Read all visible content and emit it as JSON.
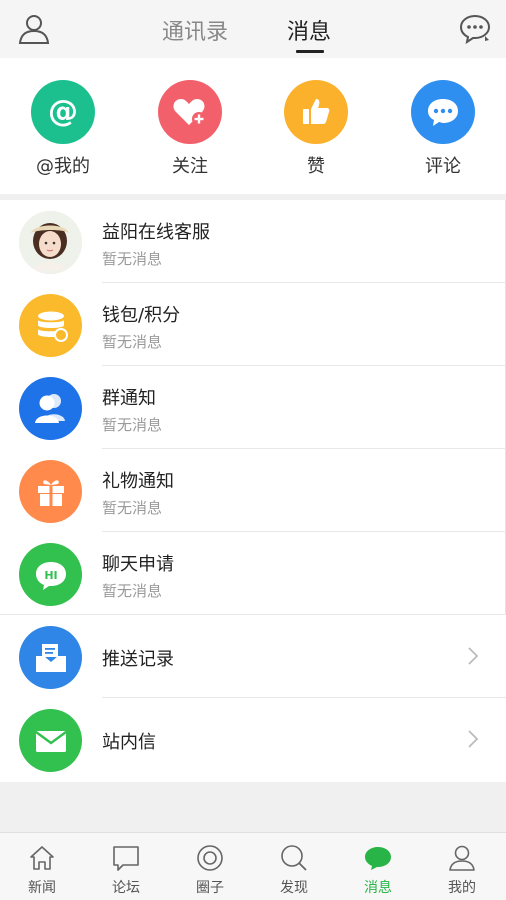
{
  "header": {
    "tabs": [
      {
        "label": "通讯录",
        "active": false
      },
      {
        "label": "消息",
        "active": true
      }
    ]
  },
  "quick_actions": [
    {
      "label": "@我的",
      "icon": "at-icon",
      "color": "#1cc08f"
    },
    {
      "label": "关注",
      "icon": "heart-plus-icon",
      "color": "#f2606b"
    },
    {
      "label": "赞",
      "icon": "thumbs-up-icon",
      "color": "#fbb12c"
    },
    {
      "label": "评论",
      "icon": "speech-bubble-icon",
      "color": "#2f8ff0"
    }
  ],
  "messages": [
    {
      "title": "益阳在线客服",
      "subtitle": "暂无消息",
      "icon": "avatar-photo"
    },
    {
      "title": "钱包/积分",
      "subtitle": "暂无消息",
      "icon": "coins-icon",
      "color": "#fbb92c"
    },
    {
      "title": "群通知",
      "subtitle": "暂无消息",
      "icon": "group-icon",
      "color": "#1f73e8"
    },
    {
      "title": "礼物通知",
      "subtitle": "暂无消息",
      "icon": "gift-icon",
      "color": "#ff8a4c"
    },
    {
      "title": "聊天申请",
      "subtitle": "暂无消息",
      "icon": "hi-bubble-icon",
      "color": "#32c04f"
    }
  ],
  "links": [
    {
      "title": "推送记录",
      "icon": "push-tray-icon",
      "color": "#2f86e6"
    },
    {
      "title": "站内信",
      "icon": "envelope-icon",
      "color": "#32c04f"
    }
  ],
  "bottom_nav": [
    {
      "label": "新闻",
      "icon": "house-icon",
      "active": false
    },
    {
      "label": "论坛",
      "icon": "comment-box-icon",
      "active": false
    },
    {
      "label": "圈子",
      "icon": "circle-target-icon",
      "active": false
    },
    {
      "label": "发现",
      "icon": "magnifier-icon",
      "active": false
    },
    {
      "label": "消息",
      "icon": "chat-bubble-icon",
      "active": true
    },
    {
      "label": "我的",
      "icon": "person-icon",
      "active": false
    }
  ],
  "colors": {
    "accent": "#28b446",
    "background": "#f0f0f0"
  }
}
